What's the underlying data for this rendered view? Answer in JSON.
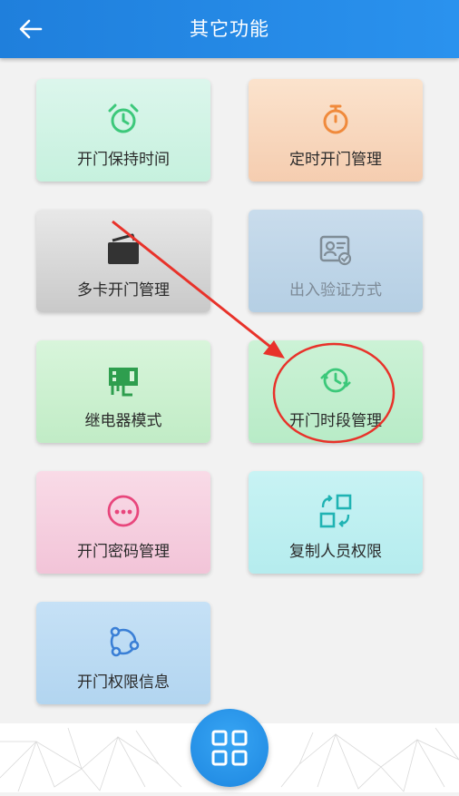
{
  "header": {
    "title": "其它功能",
    "back_icon": "arrow-left-icon"
  },
  "colors": {
    "header": "#2389e6",
    "keep_icon": "#3cc87a",
    "timed_icon": "#f08a3c",
    "multi_icon": "#333333",
    "verify_icon": "#7f8c96",
    "relay_icon": "#2e9e4e",
    "period_icon": "#3cc87a",
    "pwd_icon": "#e8467c",
    "copy_icon": "#1fb3b3",
    "info_icon": "#3a7fd6",
    "annotation": "#e8322a"
  },
  "tiles": {
    "keep": {
      "label": "开门保持时间",
      "icon": "alarm-clock-icon"
    },
    "timed": {
      "label": "定时开门管理",
      "icon": "stopwatch-icon"
    },
    "multi": {
      "label": "多卡开门管理",
      "icon": "card-stack-icon"
    },
    "verify": {
      "label": "出入验证方式",
      "icon": "id-card-verify-icon"
    },
    "relay": {
      "label": "继电器模式",
      "icon": "relay-chip-icon"
    },
    "period": {
      "label": "开门时段管理",
      "icon": "clock-cycle-icon"
    },
    "pwd": {
      "label": "开门密码管理",
      "icon": "password-dots-icon"
    },
    "copy": {
      "label": "复制人员权限",
      "icon": "copy-arrows-icon"
    },
    "info": {
      "label": "开门权限信息",
      "icon": "share-nodes-icon"
    }
  },
  "fab": {
    "icon": "grid-four-icon"
  }
}
